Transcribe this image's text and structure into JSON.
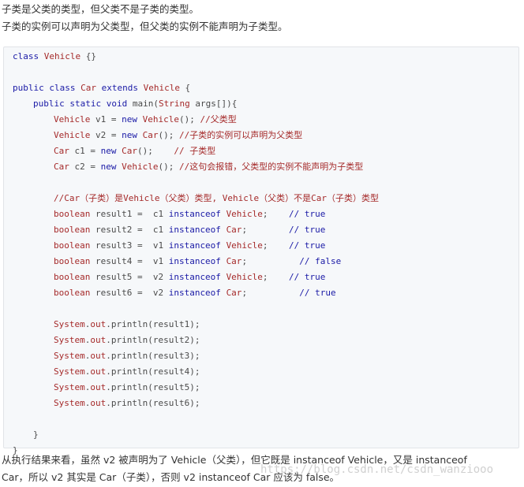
{
  "intro": [
    "子类是父类的类型，但父类不是子类的类型。",
    "子类的实例可以声明为父类型，但父类的实例不能声明为子类型。"
  ],
  "code_lines": [
    {
      "i": 0,
      "parts": [
        [
          "kw",
          "class "
        ],
        [
          "ty",
          "Vehicle"
        ],
        [
          "n",
          " {}"
        ]
      ]
    },
    {
      "i": 0,
      "parts": []
    },
    {
      "i": 0,
      "parts": [
        [
          "kw",
          "public class "
        ],
        [
          "ty",
          "Car"
        ],
        [
          "kw",
          " extends "
        ],
        [
          "ty",
          "Vehicle"
        ],
        [
          "n",
          " {"
        ]
      ]
    },
    {
      "i": 1,
      "parts": [
        [
          "kw",
          "public static void "
        ],
        [
          "n",
          "main("
        ],
        [
          "ty",
          "String"
        ],
        [
          "n",
          " args[]){"
        ]
      ]
    },
    {
      "i": 2,
      "parts": [
        [
          "ty",
          "Vehicle"
        ],
        [
          "n",
          " v1 = "
        ],
        [
          "kw",
          "new "
        ],
        [
          "ty",
          "Vehicle"
        ],
        [
          "n",
          "(); "
        ],
        [
          "cmz",
          "//父类型"
        ]
      ]
    },
    {
      "i": 2,
      "parts": [
        [
          "ty",
          "Vehicle"
        ],
        [
          "n",
          " v2 = "
        ],
        [
          "kw",
          "new "
        ],
        [
          "ty",
          "Car"
        ],
        [
          "n",
          "(); "
        ],
        [
          "cmz",
          "//子类的实例可以声明为父类型"
        ]
      ]
    },
    {
      "i": 2,
      "parts": [
        [
          "ty",
          "Car"
        ],
        [
          "n",
          " c1 = "
        ],
        [
          "kw",
          "new "
        ],
        [
          "ty",
          "Car"
        ],
        [
          "n",
          "();    "
        ],
        [
          "cmz",
          "// 子类型"
        ]
      ]
    },
    {
      "i": 2,
      "parts": [
        [
          "ty",
          "Car"
        ],
        [
          "n",
          " c2 = "
        ],
        [
          "kw",
          "new "
        ],
        [
          "ty",
          "Vehicle"
        ],
        [
          "n",
          "(); "
        ],
        [
          "cmz",
          "//这句会报错，父类型的实例不能声明为子类型"
        ]
      ]
    },
    {
      "i": 0,
      "parts": []
    },
    {
      "i": 2,
      "parts": [
        [
          "cmz",
          "//Car（子类）是Vehicle（父类）类型, Vehicle（父类）不是Car（子类）类型"
        ]
      ]
    },
    {
      "i": 2,
      "parts": [
        [
          "ty",
          "boolean"
        ],
        [
          "n",
          " result1 =  c1 "
        ],
        [
          "kw",
          "instanceof "
        ],
        [
          "ty",
          "Vehicle"
        ],
        [
          "n",
          ";    "
        ],
        [
          "cm",
          "// true"
        ]
      ]
    },
    {
      "i": 2,
      "parts": [
        [
          "ty",
          "boolean"
        ],
        [
          "n",
          " result2 =  c1 "
        ],
        [
          "kw",
          "instanceof "
        ],
        [
          "ty",
          "Car"
        ],
        [
          "n",
          ";        "
        ],
        [
          "cm",
          "// true"
        ]
      ]
    },
    {
      "i": 2,
      "parts": [
        [
          "ty",
          "boolean"
        ],
        [
          "n",
          " result3 =  v1 "
        ],
        [
          "kw",
          "instanceof "
        ],
        [
          "ty",
          "Vehicle"
        ],
        [
          "n",
          ";    "
        ],
        [
          "cm",
          "// true"
        ]
      ]
    },
    {
      "i": 2,
      "parts": [
        [
          "ty",
          "boolean"
        ],
        [
          "n",
          " result4 =  v1 "
        ],
        [
          "kw",
          "instanceof "
        ],
        [
          "ty",
          "Car"
        ],
        [
          "n",
          ";          "
        ],
        [
          "cm",
          "// false"
        ]
      ]
    },
    {
      "i": 2,
      "parts": [
        [
          "ty",
          "boolean"
        ],
        [
          "n",
          " result5 =  v2 "
        ],
        [
          "kw",
          "instanceof "
        ],
        [
          "ty",
          "Vehicle"
        ],
        [
          "n",
          ";    "
        ],
        [
          "cm",
          "// true"
        ]
      ]
    },
    {
      "i": 2,
      "parts": [
        [
          "ty",
          "boolean"
        ],
        [
          "n",
          " result6 =  v2 "
        ],
        [
          "kw",
          "instanceof "
        ],
        [
          "ty",
          "Car"
        ],
        [
          "n",
          ";          "
        ],
        [
          "cm",
          "// true"
        ]
      ]
    },
    {
      "i": 0,
      "parts": []
    },
    {
      "i": 2,
      "parts": [
        [
          "ty",
          "System"
        ],
        [
          "n",
          "."
        ],
        [
          "ty",
          "out"
        ],
        [
          "n",
          ".println(result1);"
        ]
      ]
    },
    {
      "i": 2,
      "parts": [
        [
          "ty",
          "System"
        ],
        [
          "n",
          "."
        ],
        [
          "ty",
          "out"
        ],
        [
          "n",
          ".println(result2);"
        ]
      ]
    },
    {
      "i": 2,
      "parts": [
        [
          "ty",
          "System"
        ],
        [
          "n",
          "."
        ],
        [
          "ty",
          "out"
        ],
        [
          "n",
          ".println(result3);"
        ]
      ]
    },
    {
      "i": 2,
      "parts": [
        [
          "ty",
          "System"
        ],
        [
          "n",
          "."
        ],
        [
          "ty",
          "out"
        ],
        [
          "n",
          ".println(result4);"
        ]
      ]
    },
    {
      "i": 2,
      "parts": [
        [
          "ty",
          "System"
        ],
        [
          "n",
          "."
        ],
        [
          "ty",
          "out"
        ],
        [
          "n",
          ".println(result5);"
        ]
      ]
    },
    {
      "i": 2,
      "parts": [
        [
          "ty",
          "System"
        ],
        [
          "n",
          "."
        ],
        [
          "ty",
          "out"
        ],
        [
          "n",
          ".println(result6);"
        ]
      ]
    },
    {
      "i": 0,
      "parts": []
    },
    {
      "i": 1,
      "parts": [
        [
          "n",
          "}"
        ]
      ]
    },
    {
      "i": 0,
      "parts": [
        [
          "n",
          "}"
        ]
      ]
    }
  ],
  "outro": [
    "从执行结果来看，虽然 v2 被声明为了 Vehicle（父类），但它既是 instanceof Vehicle，又是 instanceof",
    "Car，所以 v2 其实是 Car（子类），否则 v2 instanceof Car 应该为 false。"
  ],
  "watermark": "https://blog.csdn.net/csdn_wanziooo"
}
